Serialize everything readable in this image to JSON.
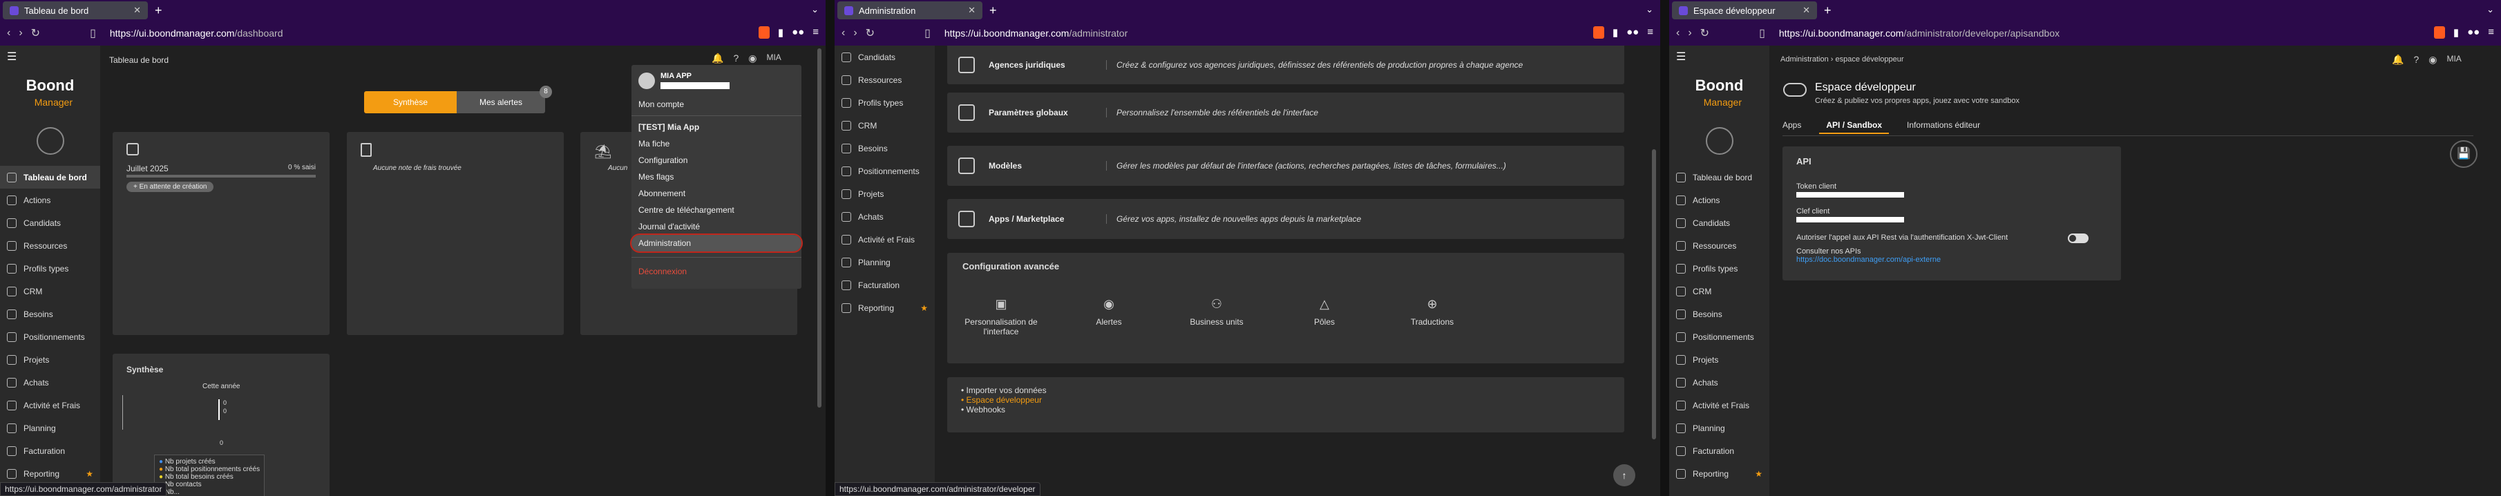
{
  "win1": {
    "tab_title": "Tableau de bord",
    "url_host": "https://ui.boondmanager.com",
    "url_path": "/dashboard",
    "page_title": "Tableau de bord",
    "toggle_synthese": "Synthèse",
    "toggle_alertes": "Mes alertes",
    "alert_count": "8",
    "month_label": "Juillet 2025",
    "percent_label": "0 % saisi",
    "status_chip": "En attente de création",
    "no_expense": "Aucune note de frais trouvée",
    "third_card_text": "Aucun",
    "synthese_title": "Synthèse",
    "chart_title": "Cette année",
    "chart_values": [
      "0",
      "0"
    ],
    "chart_zero": "0",
    "legend": [
      "Nb projets créés",
      "Nb total positionnements créés",
      "Nb total besoins créés",
      "Nb contacts",
      "Nb..."
    ],
    "user_short": "MIA",
    "status_url": "https://ui.boondmanager.com/administrator",
    "menu": {
      "name": "MIA APP",
      "account": "Mon compte",
      "app_header": "[TEST] Mia App",
      "items": [
        "Ma fiche",
        "Configuration",
        "Mes flags",
        "Abonnement",
        "Centre de téléchargement",
        "Journal d'activité",
        "Administration"
      ],
      "logout": "Déconnexion"
    }
  },
  "win2": {
    "tab_title": "Administration",
    "url_host": "https://ui.boondmanager.com",
    "url_path": "/administrator",
    "status_url": "https://ui.boondmanager.com/administrator/developer",
    "rows": [
      {
        "name": "Agences juridiques",
        "desc": "Créez & configurez vos agences juridiques, définissez des référentiels de production propres à chaque agence"
      },
      {
        "name": "Paramètres globaux",
        "desc": "Personnalisez l'ensemble des référentiels de l'interface"
      },
      {
        "name": "Modèles",
        "desc": "Gérer les modèles par défaut de l'interface (actions, recherches partagées, listes de tâches, formulaires...)"
      },
      {
        "name": "Apps / Marketplace",
        "desc": "Gérez vos apps, installez de nouvelles apps depuis la marketplace"
      }
    ],
    "advanced_title": "Configuration avancée",
    "advanced": [
      "Personnalisation de l'interface",
      "Alertes",
      "Business units",
      "Pôles",
      "Traductions"
    ],
    "links": [
      "Importer vos données",
      "Espace développeur",
      "Webhooks"
    ]
  },
  "win3": {
    "tab_title": "Espace développeur",
    "url_host": "https://ui.boondmanager.com",
    "url_path": "/administrator/developer/apisandbox",
    "breadcrumb_root": "Administration",
    "breadcrumb_leaf": "espace développeur",
    "title": "Espace développeur",
    "subtitle": "Créez & publiez vos propres apps, jouez avec votre sandbox",
    "tabs": [
      "Apps",
      "API / Sandbox",
      "Informations éditeur"
    ],
    "section": "API",
    "token_label": "Token client",
    "key_label": "Clef client",
    "xjwt_label": "Autoriser l'appel aux API Rest via l'authentification X-Jwt-Client",
    "doc_label": "Consulter nos APIs",
    "doc_link": "https://doc.boondmanager.com/api-externe"
  },
  "sidebar": [
    "Tableau de bord",
    "Actions",
    "Candidats",
    "Ressources",
    "Profils types",
    "CRM",
    "Besoins",
    "Positionnements",
    "Projets",
    "Achats",
    "Activité et Frais",
    "Planning",
    "Facturation",
    "Reporting"
  ],
  "logo": {
    "main": "Boond",
    "sub": "Manager"
  }
}
